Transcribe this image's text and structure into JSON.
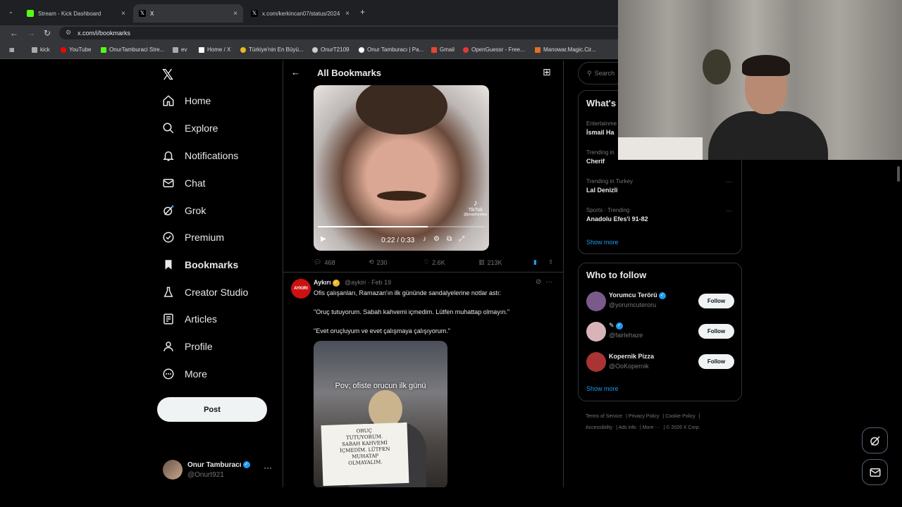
{
  "browser": {
    "tabs": [
      {
        "title": "Stream - Kick Dashboard",
        "color": "#53fc18",
        "active": false
      },
      {
        "title": "X",
        "color": "#ffffff",
        "active": true
      },
      {
        "title": "x.com/kerkincan07/status/2024",
        "color": "#ffffff",
        "active": false
      }
    ],
    "url": "x.com/i/bookmarks",
    "bookmarks": [
      {
        "label": "kick",
        "color": "#aaaaaa"
      },
      {
        "label": "YouTube",
        "color": "#ff0000"
      },
      {
        "label": "OnurTamburaci Stre...",
        "color": "#53fc18"
      },
      {
        "label": "ev",
        "color": "#aaaaaa"
      },
      {
        "label": "Home / X",
        "color": "#ffffff"
      },
      {
        "label": "Türkiye'nin En Büyü...",
        "color": "#e8b923"
      },
      {
        "label": "OnurT2109",
        "color": "#cccccc"
      },
      {
        "label": "Onur Tamburacı | Pa...",
        "color": "#ffffff"
      },
      {
        "label": "Gmail",
        "color": "#ea4335"
      },
      {
        "label": "OpenGuessr - Free...",
        "color": "#e53935"
      },
      {
        "label": "Manowar.Magic.Cir...",
        "color": "#e07020"
      }
    ]
  },
  "nav": {
    "items": [
      "Home",
      "Explore",
      "Notifications",
      "Chat",
      "Grok",
      "Premium",
      "Bookmarks",
      "Creator Studio",
      "Articles",
      "Profile",
      "More"
    ],
    "post_label": "Post",
    "user": {
      "name": "Onur Tamburacı",
      "handle": "@Onurt921"
    }
  },
  "center": {
    "title": "All Bookmarks",
    "video": {
      "time": "0:22 / 0:33",
      "progress": 0.66,
      "watermark": "TikTok",
      "watermark_handle": "@josephonbey"
    },
    "tweet1_actions": {
      "replies": "468",
      "reposts": "230",
      "likes": "2.6K",
      "views": "213K"
    },
    "tweet2": {
      "avatar_text": "AYKIRI",
      "name": "Aykırı",
      "meta": "@aykiri · Feb 19",
      "line1": "Ofis çalışanları, Ramazan'ın ilk gününde sandalyelerine notlar astı:",
      "line2": "\"Oruç tutuyorum. Sabah kahvemi içmedim. Lütfen muhattap olmayın.\"",
      "line3": "\"Evet oruçluyum ve evet çalışmaya çalışıyorum.\"",
      "image_caption": "Pov; ofiste orucun ilk günü",
      "sign_text": "ORUÇ\nTUTUYORUM.\nSABAH KAHVEMİ\nİÇMEDİM. LÜTFEN\nMUHATAP\nOLMAYALIM."
    }
  },
  "right": {
    "search_placeholder": "Search",
    "trends_title": "What's",
    "trends": [
      {
        "meta": "Entertainme",
        "name": "İsmail Ha"
      },
      {
        "meta": "Trending in",
        "name": "Cherif"
      },
      {
        "meta": "Trending in Turkey",
        "name": "Lal Denizli"
      },
      {
        "meta": "Sports · Trending",
        "name": "Anadolu Efes'i 91-82"
      }
    ],
    "show_more": "Show more",
    "who_title": "Who to follow",
    "who": [
      {
        "name": "Yorumcu Terörü",
        "handle": "@yorumcuteroru",
        "avatar": "#7a5a8a"
      },
      {
        "name": "",
        "handle": "@fairlehaze",
        "avatar": "#d8b4b8"
      },
      {
        "name": "Kopernik Pizza",
        "handle": "@OoKopernik",
        "avatar": "#a33"
      }
    ],
    "follow_label": "Follow",
    "footer": [
      "Terms of Service",
      "Privacy Policy",
      "Cookie Policy",
      "Accessibility",
      "Ads info",
      "More ···",
      "© 2026 X Corp."
    ]
  }
}
